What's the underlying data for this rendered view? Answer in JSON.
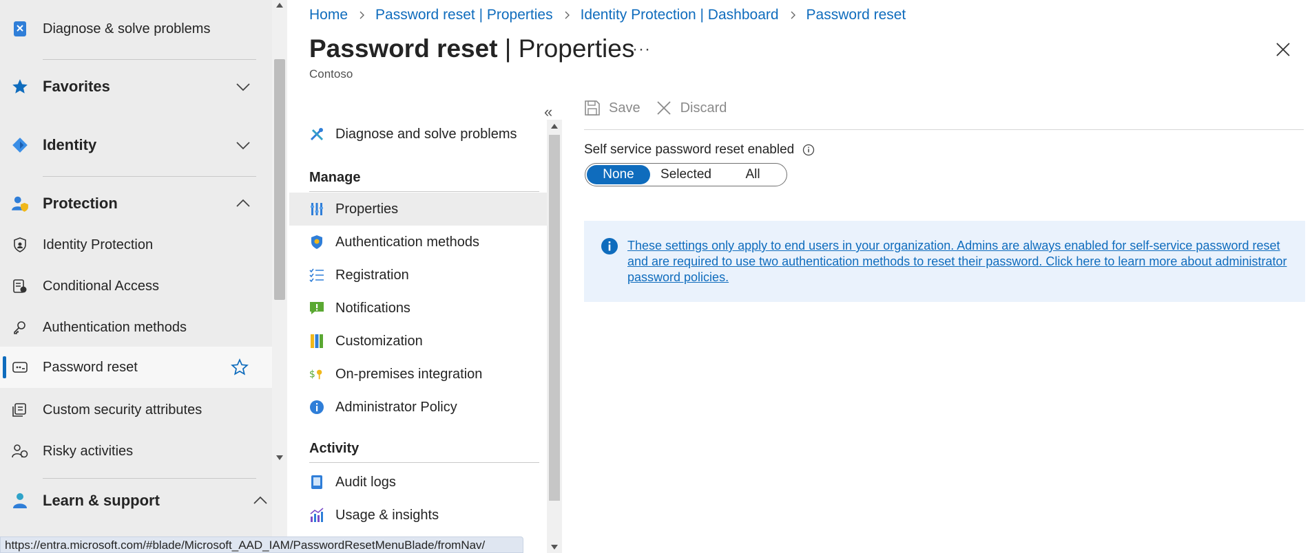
{
  "left_nav": {
    "items": [
      {
        "label": "Diagnose & solve problems",
        "icon": "diagnose-icon"
      },
      {
        "label": "Favorites",
        "icon": "star-icon"
      },
      {
        "label": "Identity",
        "icon": "identity-icon"
      },
      {
        "label": "Protection",
        "icon": "protection-icon"
      },
      {
        "label": "Identity Protection",
        "icon": "shield-icon"
      },
      {
        "label": "Conditional Access",
        "icon": "conditional-access-icon"
      },
      {
        "label": "Authentication methods",
        "icon": "key-icon"
      },
      {
        "label": "Password reset",
        "icon": "password-icon"
      },
      {
        "label": "Custom security attributes",
        "icon": "attributes-icon"
      },
      {
        "label": "Risky activities",
        "icon": "risky-activities-icon"
      },
      {
        "label": "Learn & support",
        "icon": "learn-support-icon"
      }
    ]
  },
  "status_url": "https://entra.microsoft.com/#blade/Microsoft_AAD_IAM/PasswordResetMenuBlade/fromNav/",
  "breadcrumb": [
    "Home",
    "Password reset | Properties",
    "Identity Protection | Dashboard",
    "Password reset"
  ],
  "title": {
    "strong": "Password reset",
    "rest": " | Properties"
  },
  "more_label": "···",
  "subtitle": "Contoso",
  "resource_menu": {
    "diagnose": "Diagnose and solve problems",
    "manage_heading": "Manage",
    "manage_items": [
      "Properties",
      "Authentication methods",
      "Registration",
      "Notifications",
      "Customization",
      "On-premises integration",
      "Administrator Policy"
    ],
    "activity_heading": "Activity",
    "activity_items": [
      "Audit logs",
      "Usage & insights"
    ],
    "collapse_label": "«"
  },
  "toolbar": {
    "save_label": "Save",
    "discard_label": "Discard"
  },
  "sspr": {
    "label": "Self service password reset enabled",
    "options": [
      "None",
      "Selected",
      "All"
    ],
    "selected": "None"
  },
  "info_banner": "These settings only apply to end users in your organization. Admins are always enabled for self-service password reset and are required to use two authentication methods to reset their password. Click here to learn more about administrator password policies.",
  "colors": {
    "accent": "#0f6cbd",
    "banner_bg": "#eaf2fc",
    "nav_bg": "#ececec"
  }
}
